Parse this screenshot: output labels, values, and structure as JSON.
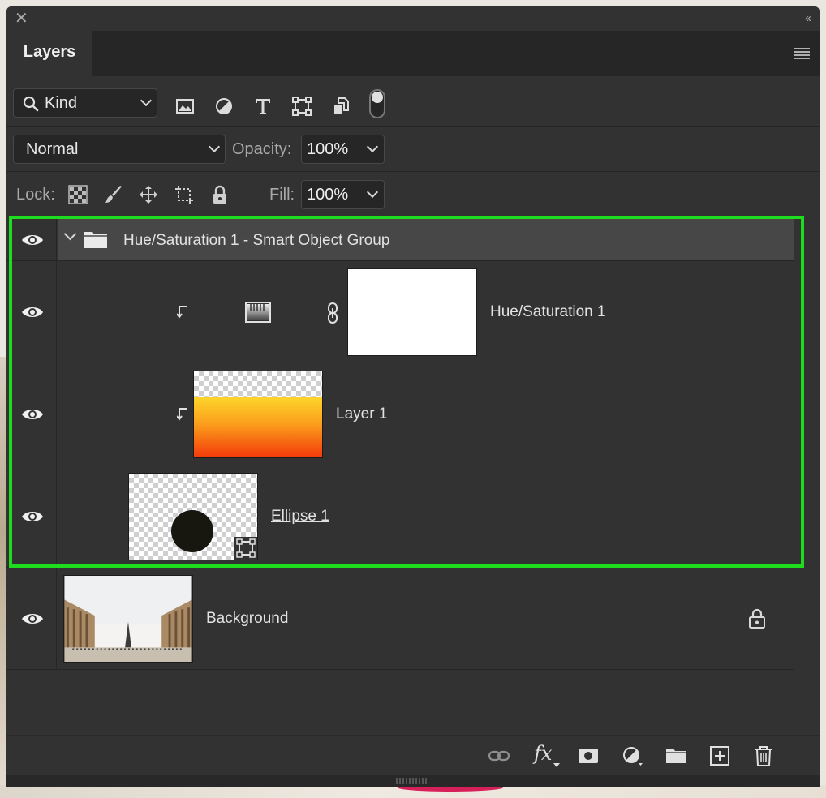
{
  "panel": {
    "tab_title": "Layers"
  },
  "filter": {
    "kind_label": "Kind",
    "icons": [
      "image-filter-icon",
      "adjustment-filter-icon",
      "type-filter-icon",
      "shape-filter-icon",
      "smart-object-filter-icon",
      "filter-toggle-icon"
    ]
  },
  "blend": {
    "mode": "Normal",
    "opacity_label": "Opacity:",
    "opacity_value": "100%"
  },
  "lock": {
    "label": "Lock:",
    "icons": [
      "lock-transparent-icon",
      "lock-image-icon",
      "lock-position-icon",
      "lock-artboard-icon",
      "lock-all-icon"
    ],
    "fill_label": "Fill:",
    "fill_value": "100%"
  },
  "layers": [
    {
      "name": "Hue/Saturation 1 - Smart Object Group",
      "type": "group",
      "expanded": true,
      "visible": true
    },
    {
      "name": "Hue/Saturation 1",
      "type": "adjustment",
      "clipped": true,
      "visible": true
    },
    {
      "name": "Layer 1",
      "type": "pixel",
      "clipped": true,
      "visible": true
    },
    {
      "name": "Ellipse 1",
      "type": "shape",
      "visible": true
    },
    {
      "name": "Background",
      "type": "background",
      "locked": true,
      "visible": true
    }
  ],
  "bottom_icons": [
    "link-layers-icon",
    "fx-icon",
    "add-mask-icon",
    "new-adjustment-icon",
    "new-group-icon",
    "new-layer-icon",
    "delete-layer-icon"
  ],
  "fx_label": "fx",
  "colors": {
    "panel": "#323232",
    "field": "#262626",
    "group_header": "#474747",
    "highlight": "#1edc1e"
  }
}
